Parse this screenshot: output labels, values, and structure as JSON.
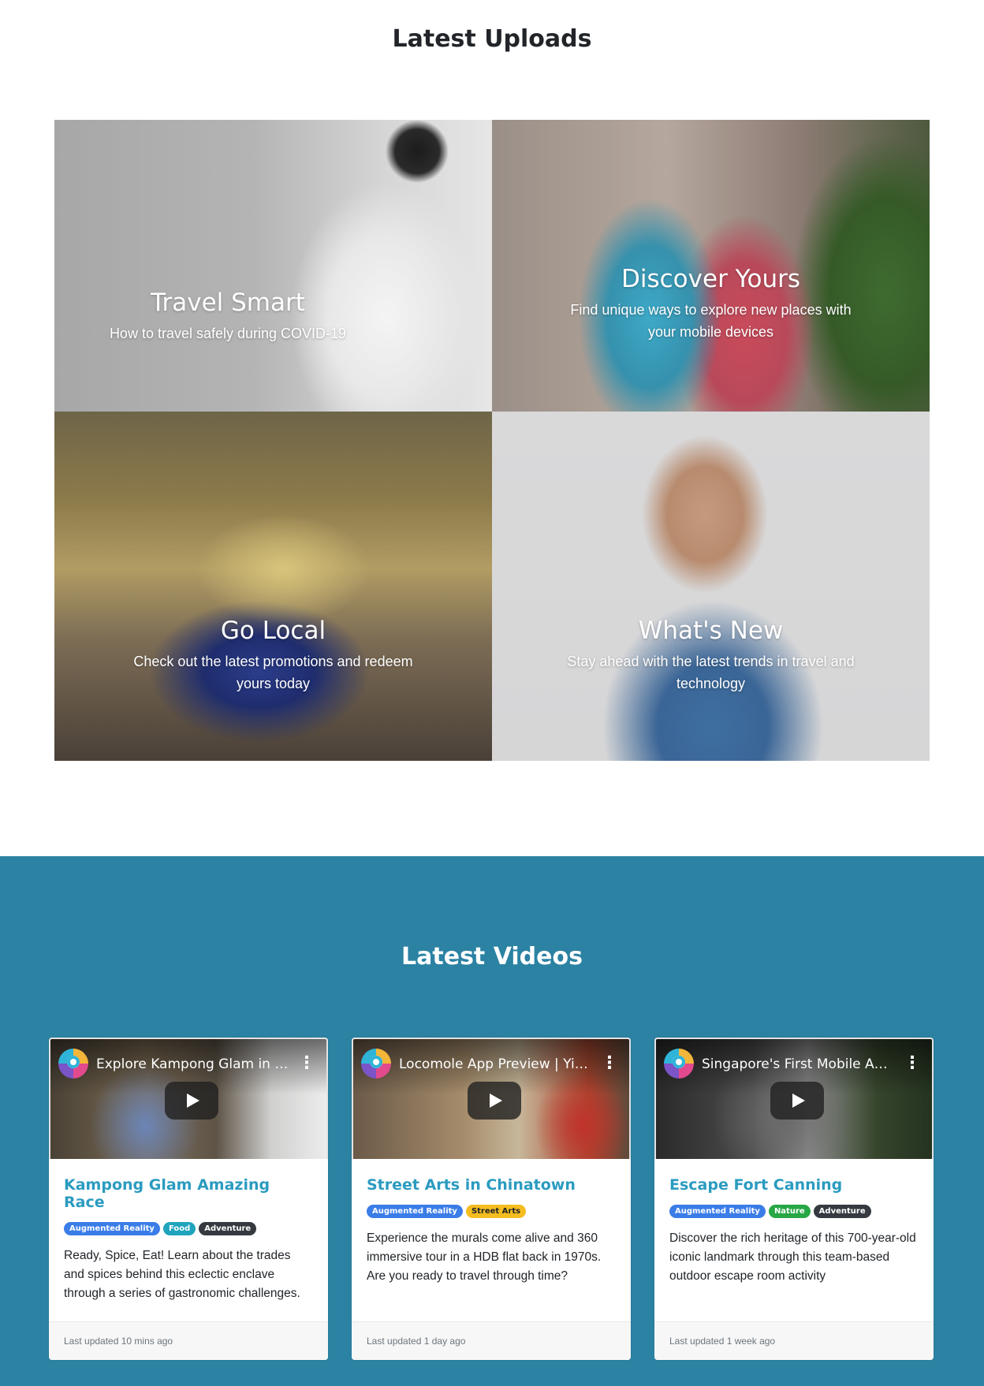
{
  "uploads": {
    "title": "Latest Uploads",
    "tiles": [
      {
        "heading": "Travel Smart",
        "subtitle": "How to travel safely during COVID-19"
      },
      {
        "heading": "Discover Yours",
        "subtitle": "Find unique ways to explore new places with your mobile devices"
      },
      {
        "heading": "Go Local",
        "subtitle": "Check out the latest promotions and redeem yours today"
      },
      {
        "heading": "What's New",
        "subtitle": "Stay ahead with the latest trends in travel and technology"
      }
    ]
  },
  "videos": {
    "title": "Latest Videos",
    "background_color": "#2b82a3",
    "cards": [
      {
        "video_title": "Explore Kampong Glam in …",
        "title": "Kampong Glam Amazing Race",
        "tags": [
          "Augmented Reality",
          "Food",
          "Adventure"
        ],
        "description": "Ready, Spice, Eat! Learn about the trades and spices behind this eclectic enclave through a series of gastronomic challenges.",
        "updated": "Last updated 10 mins ago"
      },
      {
        "video_title": "Locomole App Preview | Yi…",
        "title": "Street Arts in Chinatown",
        "tags": [
          "Augmented Reality",
          "Street Arts"
        ],
        "description": "Experience the murals come alive and 360 immersive tour in a HDB flat back in 1970s. Are you ready to travel through time?",
        "updated": "Last updated 1 day ago"
      },
      {
        "video_title": "Singapore's First Mobile A…",
        "title": "Escape Fort Canning",
        "tags": [
          "Augmented Reality",
          "Nature",
          "Adventure"
        ],
        "description": "Discover the rich heritage of this 700-year-old iconic landmark through this team-based outdoor escape room activity",
        "updated": "Last updated 1 week ago"
      }
    ]
  },
  "icons": {
    "play": "play-icon",
    "more": "more-vertical-icon",
    "channel": "channel-logo-icon"
  },
  "colors": {
    "card_title": "#2b9bc0",
    "tag_augmented_reality": "#3b7de8",
    "tag_food": "#20a4bd",
    "tag_adventure": "#343a40",
    "tag_street_arts": "#f5bd1f",
    "tag_nature": "#27a745"
  }
}
